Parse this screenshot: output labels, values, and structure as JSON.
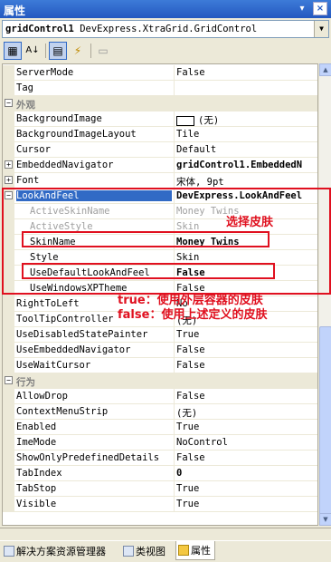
{
  "window": {
    "title": "属性",
    "pin_glyph": "▾",
    "close_glyph": "×"
  },
  "object_selector": {
    "name": "gridControl1",
    "type": "DevExpress.XtraGrid.GridControl"
  },
  "toolbar": {
    "buttons": [
      {
        "icon": "categorized-icon",
        "glyph": "▦"
      },
      {
        "icon": "alphabetical-icon",
        "glyph": "A↓"
      },
      {
        "icon": "properties-icon",
        "glyph": "▤"
      },
      {
        "icon": "events-icon",
        "glyph": "⚡"
      },
      {
        "icon": "property-pages-icon",
        "glyph": "▭"
      }
    ]
  },
  "properties": [
    {
      "name": "ServerMode",
      "value": "False"
    },
    {
      "name": "Tag",
      "value": ""
    },
    {
      "category": "外观"
    },
    {
      "name": "BackgroundImage",
      "value": "(无)",
      "swatch": true
    },
    {
      "name": "BackgroundImageLayout",
      "value": "Tile"
    },
    {
      "name": "Cursor",
      "value": "Default"
    },
    {
      "name": "EmbeddedNavigator",
      "value": "gridControl1.EmbeddedN",
      "bold": true,
      "expand": "+"
    },
    {
      "name": "Font",
      "value": "宋体, 9pt",
      "expand": "+"
    },
    {
      "name": "LookAndFeel",
      "value": "DevExpress.LookAndFeel",
      "bold": true,
      "expand": "−",
      "selected": true
    },
    {
      "name": "ActiveSkinName",
      "value": "Money Twins",
      "sub": true,
      "dim": true
    },
    {
      "name": "ActiveStyle",
      "value": "Skin",
      "sub": true,
      "dim": true
    },
    {
      "name": "SkinName",
      "value": "Money Twins",
      "sub": true,
      "bold": true
    },
    {
      "name": "Style",
      "value": "Skin",
      "sub": true
    },
    {
      "name": "UseDefaultLookAndFeel",
      "value": "False",
      "sub": true,
      "bold": true
    },
    {
      "name": "UseWindowsXPTheme",
      "value": "False",
      "sub": true
    },
    {
      "name": "RightToLeft",
      "value": "No"
    },
    {
      "name": "ToolTipController",
      "value": "(无)"
    },
    {
      "name": "UseDisabledStatePainter",
      "value": "True"
    },
    {
      "name": "UseEmbeddedNavigator",
      "value": "False"
    },
    {
      "name": "UseWaitCursor",
      "value": "False"
    },
    {
      "category": "行为"
    },
    {
      "name": "AllowDrop",
      "value": "False"
    },
    {
      "name": "ContextMenuStrip",
      "value": "(无)"
    },
    {
      "name": "Enabled",
      "value": "True"
    },
    {
      "name": "ImeMode",
      "value": "NoControl"
    },
    {
      "name": "ShowOnlyPredefinedDetails",
      "value": "False"
    },
    {
      "name": "TabIndex",
      "value": "0",
      "bold": true
    },
    {
      "name": "TabStop",
      "value": "True"
    },
    {
      "name": "Visible",
      "value": "True"
    }
  ],
  "annotations": {
    "skin": "选择皮肤",
    "true_note": "true：使用外层容器的皮肤",
    "false_note": "false：使用上述定义的皮肤"
  },
  "tabs": [
    {
      "label": "解决方案资源管理器",
      "icon": "solution-explorer-icon"
    },
    {
      "label": "类视图",
      "icon": "class-view-icon"
    },
    {
      "label": "属性",
      "icon": "properties-tab-icon",
      "active": true
    }
  ],
  "colors": {
    "annotation_red": "#e0101f",
    "selection_blue": "#316ac5",
    "titlebar_blue": "#2458c0"
  }
}
